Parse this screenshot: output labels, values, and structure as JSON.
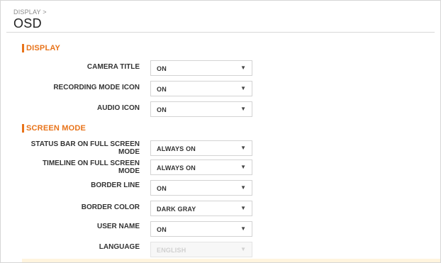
{
  "header": {
    "breadcrumb": "DISPLAY >",
    "title": "OSD"
  },
  "display_section": {
    "title": "DISPLAY",
    "rows": [
      {
        "label": "CAMERA TITLE",
        "value": "ON"
      },
      {
        "label": "RECORDING MODE ICON",
        "value": "ON"
      },
      {
        "label": "AUDIO ICON",
        "value": "ON"
      }
    ]
  },
  "screen_mode_section": {
    "title": "SCREEN MODE",
    "rows": [
      {
        "label_line1": "STATUS BAR ON FULL SCREEN",
        "label_line2": "MODE",
        "value": "ALWAYS ON"
      },
      {
        "label_line1": "TIMELINE ON FULL SCREEN",
        "label_line2": "MODE",
        "value": "ALWAYS ON"
      },
      {
        "label": "BORDER LINE",
        "value": "ON"
      },
      {
        "label": "BORDER COLOR",
        "value": "DARK GRAY"
      },
      {
        "label": "USER NAME",
        "value": "ON"
      },
      {
        "label": "LANGUAGE",
        "value": "ENGLISH",
        "disabled": true
      }
    ]
  },
  "dropdown_arrow": "▼",
  "colors": {
    "accent": "#e8731a",
    "text": "#333333",
    "border": "#d3d3d3"
  }
}
